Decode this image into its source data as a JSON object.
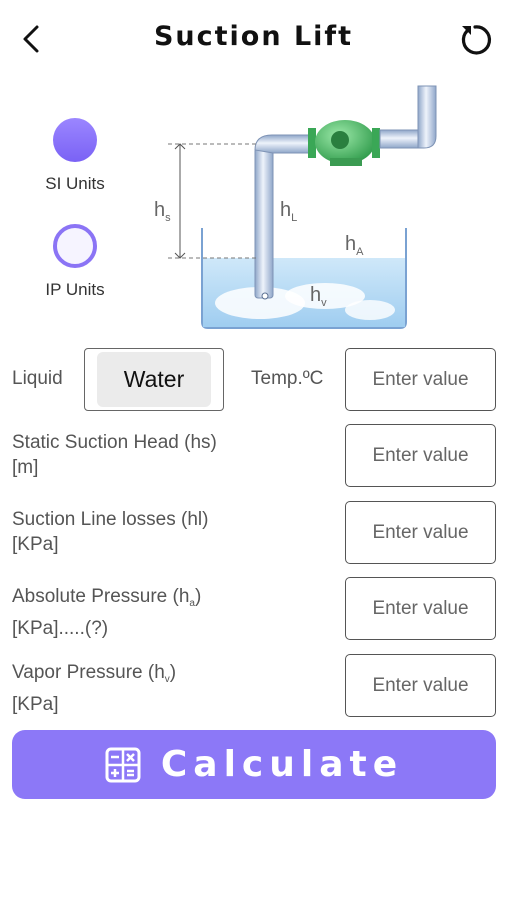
{
  "header": {
    "title": "Suction Lift",
    "back_icon": "chevron-left-icon",
    "reset_icon": "refresh-icon"
  },
  "units": [
    {
      "label": "SI Units",
      "selected": true
    },
    {
      "label": "IP Units",
      "selected": false
    }
  ],
  "diagram": {
    "labels": {
      "hs": "h",
      "hs_sub": "s",
      "hL": "h",
      "hL_sub": "L",
      "hA": "h",
      "hA_sub": "A",
      "hv": "h",
      "hv_sub": "v"
    }
  },
  "liquid": {
    "label": "Liquid",
    "value": "Water"
  },
  "temp": {
    "label": "Temp.ºC",
    "placeholder": "Enter value"
  },
  "fields": {
    "static": {
      "line1": "Static Suction Head (hs)",
      "line2": "[m]",
      "placeholder": "Enter value"
    },
    "losses": {
      "line1": "Suction Line losses (hl)",
      "line2": "[KPa]",
      "placeholder": "Enter value"
    },
    "absolute": {
      "line1": "Absolute Pressure (h",
      "sub": "a",
      "close": ")",
      "line2": "[KPa].....(?)",
      "placeholder": "Enter value"
    },
    "vapor": {
      "line1": "Vapor Pressure (h",
      "sub": "v",
      "close": ")",
      "line2": "[KPa]",
      "placeholder": "Enter value"
    }
  },
  "calculate": {
    "label": "Calculate",
    "icon": "calculator-icon"
  },
  "colors": {
    "accent": "#8c78f7",
    "pump": "#49c46a",
    "water": "#bfe0f7"
  }
}
